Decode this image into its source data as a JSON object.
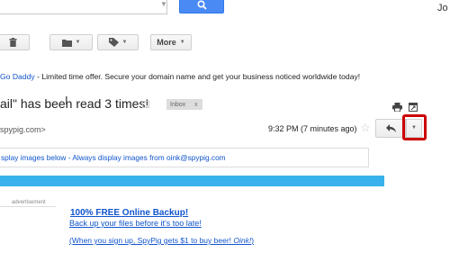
{
  "header": {
    "search_placeholder": "",
    "user_name": "Jo"
  },
  "toolbar": {
    "delete_icon": "trash-icon",
    "move_icon": "folder-icon",
    "labels_icon": "tag-icon",
    "more_label": "More"
  },
  "promo": {
    "sponsor": "Go Daddy",
    "text": " - Limited time offer. Secure your domain name and get your business noticed worldwide today!"
  },
  "message": {
    "subject": "ail\" has been read 3 times!",
    "label": "Inbox",
    "label_close": "x",
    "sender": "spypig.com>",
    "time": "9:32 PM (7 minutes ago)",
    "star": "☆"
  },
  "images_notice": "splay images below - Always display images from oink@spypig.com",
  "ad": {
    "label": "advertisement",
    "title": "100% FREE Online Backup!",
    "subtitle": "Back up your files before it's too late!",
    "beer_prefix": "(When you sign up, SpyPig gets $1 to buy beer! ",
    "beer_oink": "Oink!",
    "beer_suffix": ")"
  },
  "colors": {
    "accent_blue": "#4a8af4",
    "link": "#1155cc",
    "highlight": "#cc0000",
    "bar": "#39b1ec"
  }
}
